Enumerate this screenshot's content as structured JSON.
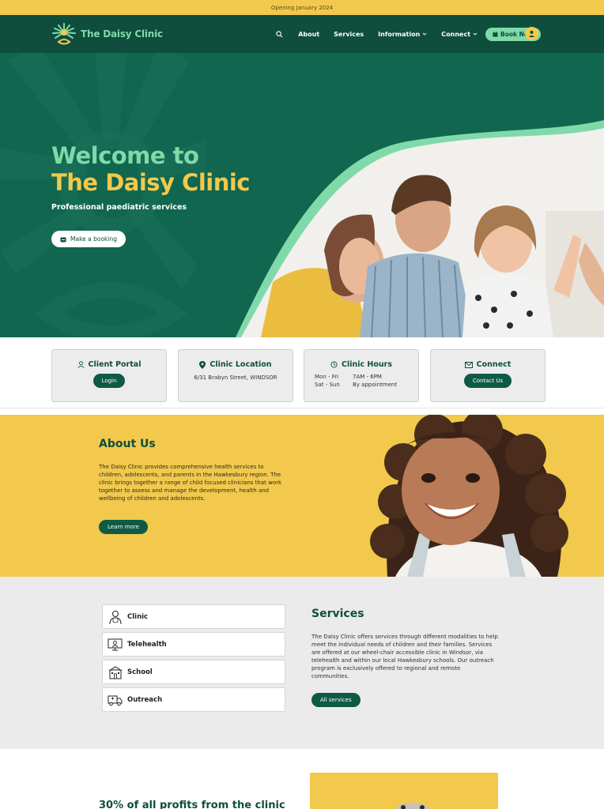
{
  "announcement": "Opening January 2024",
  "brand": {
    "name": "The Daisy Clinic"
  },
  "nav": {
    "items": [
      {
        "label": "About",
        "has_dropdown": false
      },
      {
        "label": "Services",
        "has_dropdown": false
      },
      {
        "label": "Information",
        "has_dropdown": true
      },
      {
        "label": "Connect",
        "has_dropdown": true
      }
    ],
    "book_label": "Book Now"
  },
  "hero": {
    "title_line1": "Welcome to",
    "title_line2": "The Daisy Clinic",
    "subtitle": "Professional paediatric services",
    "button_label": "Make a booking"
  },
  "cards": {
    "portal": {
      "title": "Client Portal",
      "button": "Login"
    },
    "location": {
      "title": "Clinic Location",
      "address": "6/31 Brabyn Street, WINDSOR"
    },
    "hours": {
      "title": "Clinic Hours",
      "rows": [
        {
          "days": "Mon - Fri",
          "time": "7AM - 6PM"
        },
        {
          "days": "Sat - Sun",
          "time": "By appointment"
        }
      ]
    },
    "connect": {
      "title": "Connect",
      "button": "Contact Us"
    }
  },
  "about": {
    "title": "About Us",
    "text": "The Daisy Clinic provides comprehensive health services to children, adolescents, and parents in the Hawkesbury region. The clinic brings together a range of child focused clinicians that work together to assess and manage the development, health and wellbeing of children and adolescents.",
    "button": "Learn more"
  },
  "services": {
    "items": [
      {
        "label": "Clinic",
        "icon": "doctor-icon"
      },
      {
        "label": "Telehealth",
        "icon": "telehealth-icon"
      },
      {
        "label": "School",
        "icon": "school-icon"
      },
      {
        "label": "Outreach",
        "icon": "van-icon"
      }
    ],
    "title": "Services",
    "text": "The Daisy Clinic offers services through different modalities to help meet the individual needs of children and their families. Services are offered at our wheel-chair accessible clinic in Windsor, via telehealth and within our local Hawkesbury schools.  Our outreach program is exclusively offered to regional and remote communities.",
    "button": "All services"
  },
  "profits": {
    "title": "30% of all profits from the clinic"
  },
  "colors": {
    "dark_green": "#0f4d3c",
    "hero_green": "#11664f",
    "mint": "#7fd9a9",
    "yellow": "#f2c94c",
    "light_grey": "#ebebeb"
  }
}
